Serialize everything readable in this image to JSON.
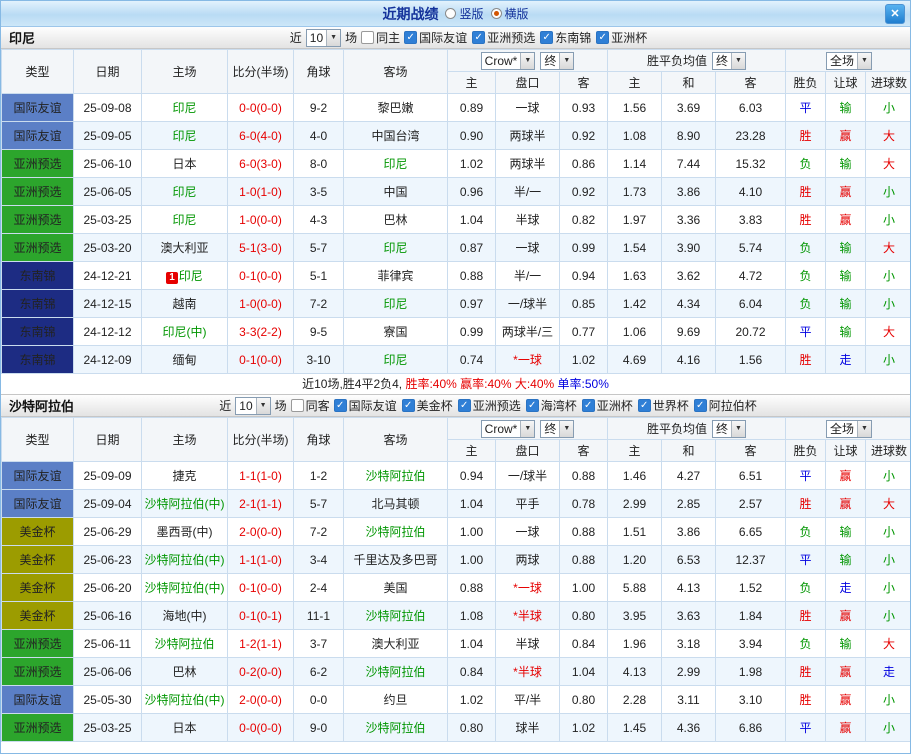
{
  "titlebar": {
    "title": "近期战绩",
    "layout_options": [
      {
        "label": "竖版",
        "selected": false
      },
      {
        "label": "横版",
        "selected": true
      }
    ],
    "close_icon": "✕"
  },
  "table_header": {
    "col_type": "类型",
    "col_date": "日期",
    "col_home": "主场",
    "col_score": "比分(半场)",
    "col_corner": "角球",
    "col_away": "客场",
    "bookmaker_select": "Crow*",
    "final_select": "终",
    "avg_label": "胜平负均值",
    "scope_select": "全场",
    "sub_home": "主",
    "sub_handicap": "盘口",
    "sub_away": "客",
    "sub_avg_home": "主",
    "sub_avg_draw": "和",
    "sub_avg_away": "客",
    "sub_result": "胜负",
    "sub_let": "让球",
    "sub_goals": "进球数"
  },
  "colors": {
    "type_bg": {
      "国际友谊": "#5b7fc6",
      "亚洲预选": "#2ca52c",
      "东南锦": "#1d2c83",
      "美金杯": "#9c9c00"
    },
    "win": "#e60000",
    "draw": "#0000e0",
    "lose": "#009600",
    "score": "#e60000",
    "focus_team": "#009600"
  },
  "sections": [
    {
      "team": "印尼",
      "filter": {
        "near_label": "近",
        "count": "10",
        "games_label": "场",
        "same_label": "同主",
        "same_checked": false,
        "leagues": [
          "国际友谊",
          "亚洲预选",
          "东南锦",
          "亚洲杯"
        ]
      },
      "rows": [
        {
          "type": "国际友谊",
          "date": "25-09-08",
          "home": "印尼",
          "score": "0-0(0-0)",
          "corner": "9-2",
          "away": "黎巴嫩",
          "home_water": "0.89",
          "handicap": "一球",
          "away_water": "0.93",
          "avg_win": "1.56",
          "avg_draw": "3.69",
          "avg_lose": "6.03",
          "result": "平",
          "let_result": "输",
          "goal_result": "小"
        },
        {
          "type": "国际友谊",
          "date": "25-09-05",
          "home": "印尼",
          "score": "6-0(4-0)",
          "corner": "4-0",
          "away": "中国台湾",
          "home_water": "0.90",
          "handicap": "两球半",
          "away_water": "0.92",
          "avg_win": "1.08",
          "avg_draw": "8.90",
          "avg_lose": "23.28",
          "result": "胜",
          "let_result": "赢",
          "goal_result": "大"
        },
        {
          "type": "亚洲预选",
          "date": "25-06-10",
          "home": "日本",
          "score": "6-0(3-0)",
          "corner": "8-0",
          "away": "印尼",
          "home_water": "1.02",
          "handicap": "两球半",
          "away_water": "0.86",
          "avg_win": "1.14",
          "avg_draw": "7.44",
          "avg_lose": "15.32",
          "result": "负",
          "let_result": "输",
          "goal_result": "大"
        },
        {
          "type": "亚洲预选",
          "date": "25-06-05",
          "home": "印尼",
          "score": "1-0(1-0)",
          "corner": "3-5",
          "away": "中国",
          "home_water": "0.96",
          "handicap": "半/一",
          "away_water": "0.92",
          "avg_win": "1.73",
          "avg_draw": "3.86",
          "avg_lose": "4.10",
          "result": "胜",
          "let_result": "赢",
          "goal_result": "小"
        },
        {
          "type": "亚洲预选",
          "date": "25-03-25",
          "home": "印尼",
          "score": "1-0(0-0)",
          "corner": "4-3",
          "away": "巴林",
          "home_water": "1.04",
          "handicap": "半球",
          "away_water": "0.82",
          "avg_win": "1.97",
          "avg_draw": "3.36",
          "avg_lose": "3.83",
          "result": "胜",
          "let_result": "赢",
          "goal_result": "小"
        },
        {
          "type": "亚洲预选",
          "date": "25-03-20",
          "home": "澳大利亚",
          "score": "5-1(3-0)",
          "corner": "5-7",
          "away": "印尼",
          "home_water": "0.87",
          "handicap": "一球",
          "away_water": "0.99",
          "avg_win": "1.54",
          "avg_draw": "3.90",
          "avg_lose": "5.74",
          "result": "负",
          "let_result": "输",
          "goal_result": "大"
        },
        {
          "type": "东南锦",
          "date": "24-12-21",
          "home": "印尼",
          "home_badge": "1",
          "score": "0-1(0-0)",
          "corner": "5-1",
          "away": "菲律宾",
          "home_water": "0.88",
          "handicap": "半/一",
          "away_water": "0.94",
          "avg_win": "1.63",
          "avg_draw": "3.62",
          "avg_lose": "4.72",
          "result": "负",
          "let_result": "输",
          "goal_result": "小"
        },
        {
          "type": "东南锦",
          "date": "24-12-15",
          "home": "越南",
          "score": "1-0(0-0)",
          "corner": "7-2",
          "away": "印尼",
          "home_water": "0.97",
          "handicap": "一/球半",
          "away_water": "0.85",
          "avg_win": "1.42",
          "avg_draw": "4.34",
          "avg_lose": "6.04",
          "result": "负",
          "let_result": "输",
          "goal_result": "小"
        },
        {
          "type": "东南锦",
          "date": "24-12-12",
          "home": "印尼(中)",
          "score": "3-3(2-2)",
          "corner": "9-5",
          "away": "寮国",
          "home_water": "0.99",
          "handicap": "两球半/三",
          "away_water": "0.77",
          "avg_win": "1.06",
          "avg_draw": "9.69",
          "avg_lose": "20.72",
          "result": "平",
          "let_result": "输",
          "goal_result": "大"
        },
        {
          "type": "东南锦",
          "date": "24-12-09",
          "home": "缅甸",
          "score": "0-1(0-0)",
          "corner": "3-10",
          "away": "印尼",
          "home_water": "0.74",
          "handicap": "*一球",
          "away_water": "1.02",
          "avg_win": "4.69",
          "avg_draw": "4.16",
          "avg_lose": "1.56",
          "result": "胜",
          "let_result": "走",
          "goal_result": "小"
        }
      ],
      "summary": [
        {
          "text": "近10场,胜4平2负4, ",
          "color": "#222222"
        },
        {
          "text": "胜率:40% ",
          "color": "#e60000"
        },
        {
          "text": "赢率:40% ",
          "color": "#e60000"
        },
        {
          "text": "大:40% ",
          "color": "#e60000"
        },
        {
          "text": "单率:50%",
          "color": "#0000e0"
        }
      ]
    },
    {
      "team": "沙特阿拉伯",
      "filter": {
        "near_label": "近",
        "count": "10",
        "games_label": "场",
        "same_label": "同客",
        "same_checked": false,
        "leagues": [
          "国际友谊",
          "美金杯",
          "亚洲预选",
          "海湾杯",
          "亚洲杯",
          "世界杯",
          "阿拉伯杯"
        ]
      },
      "rows": [
        {
          "type": "国际友谊",
          "date": "25-09-09",
          "home": "捷克",
          "score": "1-1(1-0)",
          "corner": "1-2",
          "away": "沙特阿拉伯",
          "home_water": "0.94",
          "handicap": "一/球半",
          "away_water": "0.88",
          "avg_win": "1.46",
          "avg_draw": "4.27",
          "avg_lose": "6.51",
          "result": "平",
          "let_result": "赢",
          "goal_result": "小"
        },
        {
          "type": "国际友谊",
          "date": "25-09-04",
          "home": "沙特阿拉伯(中)",
          "score": "2-1(1-1)",
          "corner": "5-7",
          "away": "北马其顿",
          "home_water": "1.04",
          "handicap": "平手",
          "away_water": "0.78",
          "avg_win": "2.99",
          "avg_draw": "2.85",
          "avg_lose": "2.57",
          "result": "胜",
          "let_result": "赢",
          "goal_result": "大"
        },
        {
          "type": "美金杯",
          "date": "25-06-29",
          "home": "墨西哥(中)",
          "score": "2-0(0-0)",
          "corner": "7-2",
          "away": "沙特阿拉伯",
          "home_water": "1.00",
          "handicap": "一球",
          "away_water": "0.88",
          "avg_win": "1.51",
          "avg_draw": "3.86",
          "avg_lose": "6.65",
          "result": "负",
          "let_result": "输",
          "goal_result": "小"
        },
        {
          "type": "美金杯",
          "date": "25-06-23",
          "home": "沙特阿拉伯(中)",
          "score": "1-1(1-0)",
          "corner": "3-4",
          "away": "千里达及多巴哥",
          "home_water": "1.00",
          "handicap": "两球",
          "away_water": "0.88",
          "avg_win": "1.20",
          "avg_draw": "6.53",
          "avg_lose": "12.37",
          "result": "平",
          "let_result": "输",
          "goal_result": "小"
        },
        {
          "type": "美金杯",
          "date": "25-06-20",
          "home": "沙特阿拉伯(中)",
          "score": "0-1(0-0)",
          "corner": "2-4",
          "away": "美国",
          "home_water": "0.88",
          "handicap": "*一球",
          "away_water": "1.00",
          "avg_win": "5.88",
          "avg_draw": "4.13",
          "avg_lose": "1.52",
          "result": "负",
          "let_result": "走",
          "goal_result": "小"
        },
        {
          "type": "美金杯",
          "date": "25-06-16",
          "home": "海地(中)",
          "score": "0-1(0-1)",
          "corner": "11-1",
          "away": "沙特阿拉伯",
          "home_water": "1.08",
          "handicap": "*半球",
          "away_water": "0.80",
          "avg_win": "3.95",
          "avg_draw": "3.63",
          "avg_lose": "1.84",
          "result": "胜",
          "let_result": "赢",
          "goal_result": "小"
        },
        {
          "type": "亚洲预选",
          "date": "25-06-11",
          "home": "沙特阿拉伯",
          "score": "1-2(1-1)",
          "corner": "3-7",
          "away": "澳大利亚",
          "home_water": "1.04",
          "handicap": "半球",
          "away_water": "0.84",
          "avg_win": "1.96",
          "avg_draw": "3.18",
          "avg_lose": "3.94",
          "result": "负",
          "let_result": "输",
          "goal_result": "大"
        },
        {
          "type": "亚洲预选",
          "date": "25-06-06",
          "home": "巴林",
          "score": "0-2(0-0)",
          "corner": "6-2",
          "away": "沙特阿拉伯",
          "home_water": "0.84",
          "handicap": "*半球",
          "away_water": "1.04",
          "avg_win": "4.13",
          "avg_draw": "2.99",
          "avg_lose": "1.98",
          "result": "胜",
          "let_result": "赢",
          "goal_result": "走"
        },
        {
          "type": "国际友谊",
          "date": "25-05-30",
          "home": "沙特阿拉伯(中)",
          "score": "2-0(0-0)",
          "corner": "0-0",
          "away": "约旦",
          "home_water": "1.02",
          "handicap": "平/半",
          "away_water": "0.80",
          "avg_win": "2.28",
          "avg_draw": "3.11",
          "avg_lose": "3.10",
          "result": "胜",
          "let_result": "赢",
          "goal_result": "小"
        },
        {
          "type": "亚洲预选",
          "date": "25-03-25",
          "home": "日本",
          "score": "0-0(0-0)",
          "corner": "9-0",
          "away": "沙特阿拉伯",
          "home_water": "0.80",
          "handicap": "球半",
          "away_water": "1.02",
          "avg_win": "1.45",
          "avg_draw": "4.36",
          "avg_lose": "6.86",
          "result": "平",
          "let_result": "赢",
          "goal_result": "小"
        }
      ]
    }
  ]
}
